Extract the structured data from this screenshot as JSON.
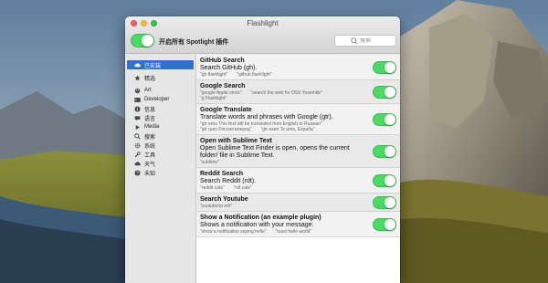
{
  "window": {
    "title": "Flashlight"
  },
  "toolbar": {
    "master_toggle_label": "开启所有 Spotlight 插件",
    "master_toggle_on": true,
    "search_placeholder": "搜索"
  },
  "sidebar": {
    "items": [
      {
        "label": "已安装",
        "icon": "cloud-icon",
        "selected": true
      },
      {
        "label": "精选",
        "icon": "star-icon"
      },
      {
        "label": "Art",
        "icon": "palette-icon"
      },
      {
        "label": "Developer",
        "icon": "terminal-icon"
      },
      {
        "label": "信息",
        "icon": "info-icon"
      },
      {
        "label": "语言",
        "icon": "language-icon"
      },
      {
        "label": "Media",
        "icon": "play-icon"
      },
      {
        "label": "搜索",
        "icon": "search-icon"
      },
      {
        "label": "系统",
        "icon": "gear-icon"
      },
      {
        "label": "工具",
        "icon": "wrench-icon"
      },
      {
        "label": "天气",
        "icon": "cloud-weather-icon"
      },
      {
        "label": "未知",
        "icon": "question-icon"
      }
    ]
  },
  "plugins": [
    {
      "name": "GitHub Search",
      "description": "Search GitHub (gh).",
      "examples": [
        "\"gh flashlight\"",
        "\"github flashlight\""
      ],
      "enabled": true
    },
    {
      "name": "Google Search",
      "description": "",
      "examples": [
        "\"google Apple stock\"",
        "\"search the web for OSX Yosemite\"",
        "\"g Flashlight\""
      ],
      "enabled": true
    },
    {
      "name": "Google Translate",
      "description": "Translate words and phrases with Google (gtr).",
      "examples": [
        "\"gtr enru This text will be translated from English to Russian\"",
        "\"gtr ruen Россия вперед\"",
        "\"gtr esen Te amo, España\""
      ],
      "enabled": true
    },
    {
      "name": "Open with Sublime Text",
      "description": "Open Sublime Text Finder is open, opens the current folder/ file in Sublime Text.",
      "examples": [
        "\"sublime\""
      ],
      "enabled": true
    },
    {
      "name": "Reddit Search",
      "description": "Search Reddit (rdt).",
      "examples": [
        "\"reddit cats\"",
        "\"rdt cats\""
      ],
      "enabled": true
    },
    {
      "name": "Search Youtube",
      "description": "",
      "examples": [
        "\"youtube/yt erb\""
      ],
      "enabled": true
    },
    {
      "name": "Show a Notification (an example plugin)",
      "description": "Shows a notification with your message.",
      "examples": [
        "\"show a notification saying hello\"",
        "\"toast hello world\""
      ],
      "enabled": true
    }
  ],
  "colors": {
    "toggle_on": "#4cd964",
    "selection": "#2f6fd6"
  }
}
